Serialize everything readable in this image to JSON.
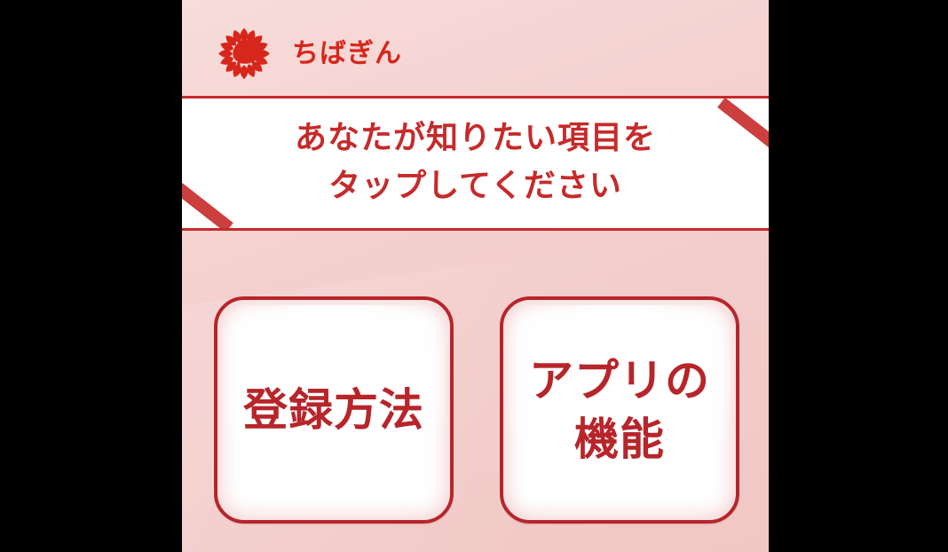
{
  "app": {
    "brand_name": "ちばぎん",
    "colors": {
      "brand_red": "#d7261b",
      "accent_red": "#c62a2a",
      "card_border": "#b7252a"
    }
  },
  "banner": {
    "line1": "あなたが知りたい項目を",
    "line2": "タップしてください"
  },
  "cards": [
    {
      "label": "登録方法"
    },
    {
      "label": "アプリの\n機能"
    }
  ],
  "icons": {
    "logo": "chibagin-flower-logo-icon"
  }
}
